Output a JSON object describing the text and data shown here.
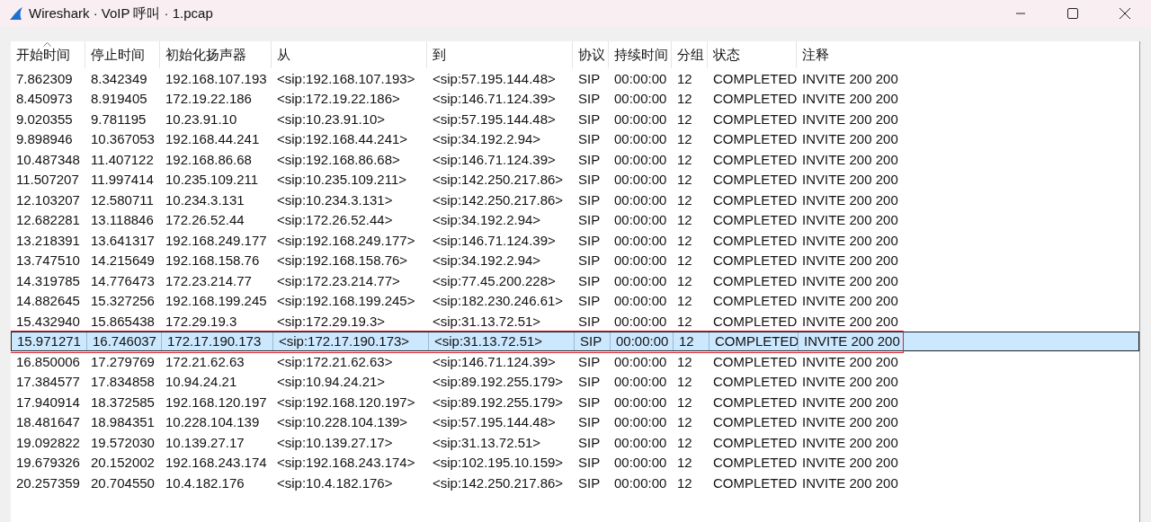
{
  "window": {
    "title": "Wireshark · VoIP 呼叫 · 1.pcap"
  },
  "table": {
    "columns": [
      {
        "label": "开始时间",
        "sorted": true
      },
      {
        "label": "停止时间",
        "sorted": false
      },
      {
        "label": "初始化扬声器",
        "sorted": false
      },
      {
        "label": "从",
        "sorted": false
      },
      {
        "label": "到",
        "sorted": false
      },
      {
        "label": "协议",
        "sorted": false
      },
      {
        "label": "持续时间",
        "sorted": false
      },
      {
        "label": "分组",
        "sorted": false
      },
      {
        "label": "状态",
        "sorted": false
      },
      {
        "label": "注释",
        "sorted": false
      }
    ],
    "rows": [
      {
        "selected": false,
        "marked": false,
        "cells": [
          "7.862309",
          "8.342349",
          "192.168.107.193",
          "<sip:192.168.107.193>",
          "<sip:57.195.144.48>",
          "SIP",
          "00:00:00",
          "12",
          "COMPLETED",
          "INVITE 200 200"
        ]
      },
      {
        "selected": false,
        "marked": false,
        "cells": [
          "8.450973",
          "8.919405",
          "172.19.22.186",
          "<sip:172.19.22.186>",
          "<sip:146.71.124.39>",
          "SIP",
          "00:00:00",
          "12",
          "COMPLETED",
          "INVITE 200 200"
        ]
      },
      {
        "selected": false,
        "marked": false,
        "cells": [
          "9.020355",
          "9.781195",
          "10.23.91.10",
          "<sip:10.23.91.10>",
          "<sip:57.195.144.48>",
          "SIP",
          "00:00:00",
          "12",
          "COMPLETED",
          "INVITE 200 200"
        ]
      },
      {
        "selected": false,
        "marked": false,
        "cells": [
          "9.898946",
          "10.367053",
          "192.168.44.241",
          "<sip:192.168.44.241>",
          "<sip:34.192.2.94>",
          "SIP",
          "00:00:00",
          "12",
          "COMPLETED",
          "INVITE 200 200"
        ]
      },
      {
        "selected": false,
        "marked": false,
        "cells": [
          "10.487348",
          "11.407122",
          "192.168.86.68",
          "<sip:192.168.86.68>",
          "<sip:146.71.124.39>",
          "SIP",
          "00:00:00",
          "12",
          "COMPLETED",
          "INVITE 200 200"
        ]
      },
      {
        "selected": false,
        "marked": false,
        "cells": [
          "11.507207",
          "11.997414",
          "10.235.109.211",
          "<sip:10.235.109.211>",
          "<sip:142.250.217.86>",
          "SIP",
          "00:00:00",
          "12",
          "COMPLETED",
          "INVITE 200 200"
        ]
      },
      {
        "selected": false,
        "marked": false,
        "cells": [
          "12.103207",
          "12.580711",
          "10.234.3.131",
          "<sip:10.234.3.131>",
          "<sip:142.250.217.86>",
          "SIP",
          "00:00:00",
          "12",
          "COMPLETED",
          "INVITE 200 200"
        ]
      },
      {
        "selected": false,
        "marked": false,
        "cells": [
          "12.682281",
          "13.118846",
          "172.26.52.44",
          "<sip:172.26.52.44>",
          "<sip:34.192.2.94>",
          "SIP",
          "00:00:00",
          "12",
          "COMPLETED",
          "INVITE 200 200"
        ]
      },
      {
        "selected": false,
        "marked": false,
        "cells": [
          "13.218391",
          "13.641317",
          "192.168.249.177",
          "<sip:192.168.249.177>",
          "<sip:146.71.124.39>",
          "SIP",
          "00:00:00",
          "12",
          "COMPLETED",
          "INVITE 200 200"
        ]
      },
      {
        "selected": false,
        "marked": false,
        "cells": [
          "13.747510",
          "14.215649",
          "192.168.158.76",
          "<sip:192.168.158.76>",
          "<sip:34.192.2.94>",
          "SIP",
          "00:00:00",
          "12",
          "COMPLETED",
          "INVITE 200 200"
        ]
      },
      {
        "selected": false,
        "marked": false,
        "cells": [
          "14.319785",
          "14.776473",
          "172.23.214.77",
          "<sip:172.23.214.77>",
          "<sip:77.45.200.228>",
          "SIP",
          "00:00:00",
          "12",
          "COMPLETED",
          "INVITE 200 200"
        ]
      },
      {
        "selected": false,
        "marked": false,
        "cells": [
          "14.882645",
          "15.327256",
          "192.168.199.245",
          "<sip:192.168.199.245>",
          "<sip:182.230.246.61>",
          "SIP",
          "00:00:00",
          "12",
          "COMPLETED",
          "INVITE 200 200"
        ]
      },
      {
        "selected": false,
        "marked": false,
        "cells": [
          "15.432940",
          "15.865438",
          "172.29.19.3",
          "<sip:172.29.19.3>",
          "<sip:31.13.72.51>",
          "SIP",
          "00:00:00",
          "12",
          "COMPLETED",
          "INVITE 200 200"
        ]
      },
      {
        "selected": true,
        "marked": true,
        "cells": [
          "15.971271",
          "16.746037",
          "172.17.190.173",
          "<sip:172.17.190.173>",
          "<sip:31.13.72.51>",
          "SIP",
          "00:00:00",
          "12",
          "COMPLETED",
          "INVITE 200 200"
        ]
      },
      {
        "selected": false,
        "marked": false,
        "cells": [
          "16.850006",
          "17.279769",
          "172.21.62.63",
          "<sip:172.21.62.63>",
          "<sip:146.71.124.39>",
          "SIP",
          "00:00:00",
          "12",
          "COMPLETED",
          "INVITE 200 200"
        ]
      },
      {
        "selected": false,
        "marked": false,
        "cells": [
          "17.384577",
          "17.834858",
          "10.94.24.21",
          "<sip:10.94.24.21>",
          "<sip:89.192.255.179>",
          "SIP",
          "00:00:00",
          "12",
          "COMPLETED",
          "INVITE 200 200"
        ]
      },
      {
        "selected": false,
        "marked": false,
        "cells": [
          "17.940914",
          "18.372585",
          "192.168.120.197",
          "<sip:192.168.120.197>",
          "<sip:89.192.255.179>",
          "SIP",
          "00:00:00",
          "12",
          "COMPLETED",
          "INVITE 200 200"
        ]
      },
      {
        "selected": false,
        "marked": false,
        "cells": [
          "18.481647",
          "18.984351",
          "10.228.104.139",
          "<sip:10.228.104.139>",
          "<sip:57.195.144.48>",
          "SIP",
          "00:00:00",
          "12",
          "COMPLETED",
          "INVITE 200 200"
        ]
      },
      {
        "selected": false,
        "marked": false,
        "cells": [
          "19.092822",
          "19.572030",
          "10.139.27.17",
          "<sip:10.139.27.17>",
          "<sip:31.13.72.51>",
          "SIP",
          "00:00:00",
          "12",
          "COMPLETED",
          "INVITE 200 200"
        ]
      },
      {
        "selected": false,
        "marked": false,
        "cells": [
          "19.679326",
          "20.152002",
          "192.168.243.174",
          "<sip:192.168.243.174>",
          "<sip:102.195.10.159>",
          "SIP",
          "00:00:00",
          "12",
          "COMPLETED",
          "INVITE 200 200"
        ]
      },
      {
        "selected": false,
        "marked": false,
        "cells": [
          "20.257359",
          "20.704550",
          "10.4.182.176",
          "<sip:10.4.182.176>",
          "<sip:142.250.217.86>",
          "SIP",
          "00:00:00",
          "12",
          "COMPLETED",
          "INVITE 200 200"
        ]
      }
    ]
  }
}
